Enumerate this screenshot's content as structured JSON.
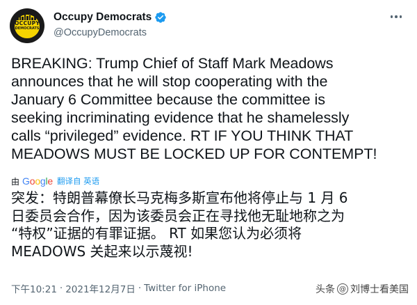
{
  "account": {
    "display_name": "Occupy Democrats",
    "handle": "@OccupyDemocrats",
    "avatar_text_line1": "OCCUPY",
    "avatar_text_line2": "DEMOCRATS",
    "verified": true,
    "verified_color": "#1d9bf0"
  },
  "tweet": {
    "lines": [
      "BREAKING: Trump Chief of Staff Mark Meadows",
      "announces that he will stop cooperating with the",
      "January 6 Committee because the committee is",
      "seeking incriminating evidence that he shamelessly",
      "calls “privileged” evidence. RT IF YOU THINK THAT",
      "MEADOWS MUST BE LOCKED UP FOR CONTEMPT!"
    ]
  },
  "translation": {
    "by_label": "由",
    "provider": "Google",
    "link_label": "翻译自 英语",
    "lines": [
      "突发：特朗普幕僚长马克梅多斯宣布他将停止与 1 月 6",
      "日委员会合作，因为该委员会正在寻找他无耻地称之为",
      "“特权”证据的有罪证据。 RT 如果您认为必须将",
      "MEADOWS 关起来以示蔑视!"
    ]
  },
  "meta": {
    "time": "下午10:21",
    "date": "2021年12月7日",
    "separator": "·",
    "source": "Twitter for iPhone"
  },
  "watermark": {
    "prefix": "头条",
    "icon": "@",
    "author": "刘博士看美国"
  },
  "colors": {
    "text": "#0f1419",
    "secondary": "#536471",
    "link": "#1d9bf0",
    "google_blue": "#4285f4",
    "google_red": "#ea4335",
    "google_yellow": "#fbbc05",
    "google_green": "#34a853"
  }
}
